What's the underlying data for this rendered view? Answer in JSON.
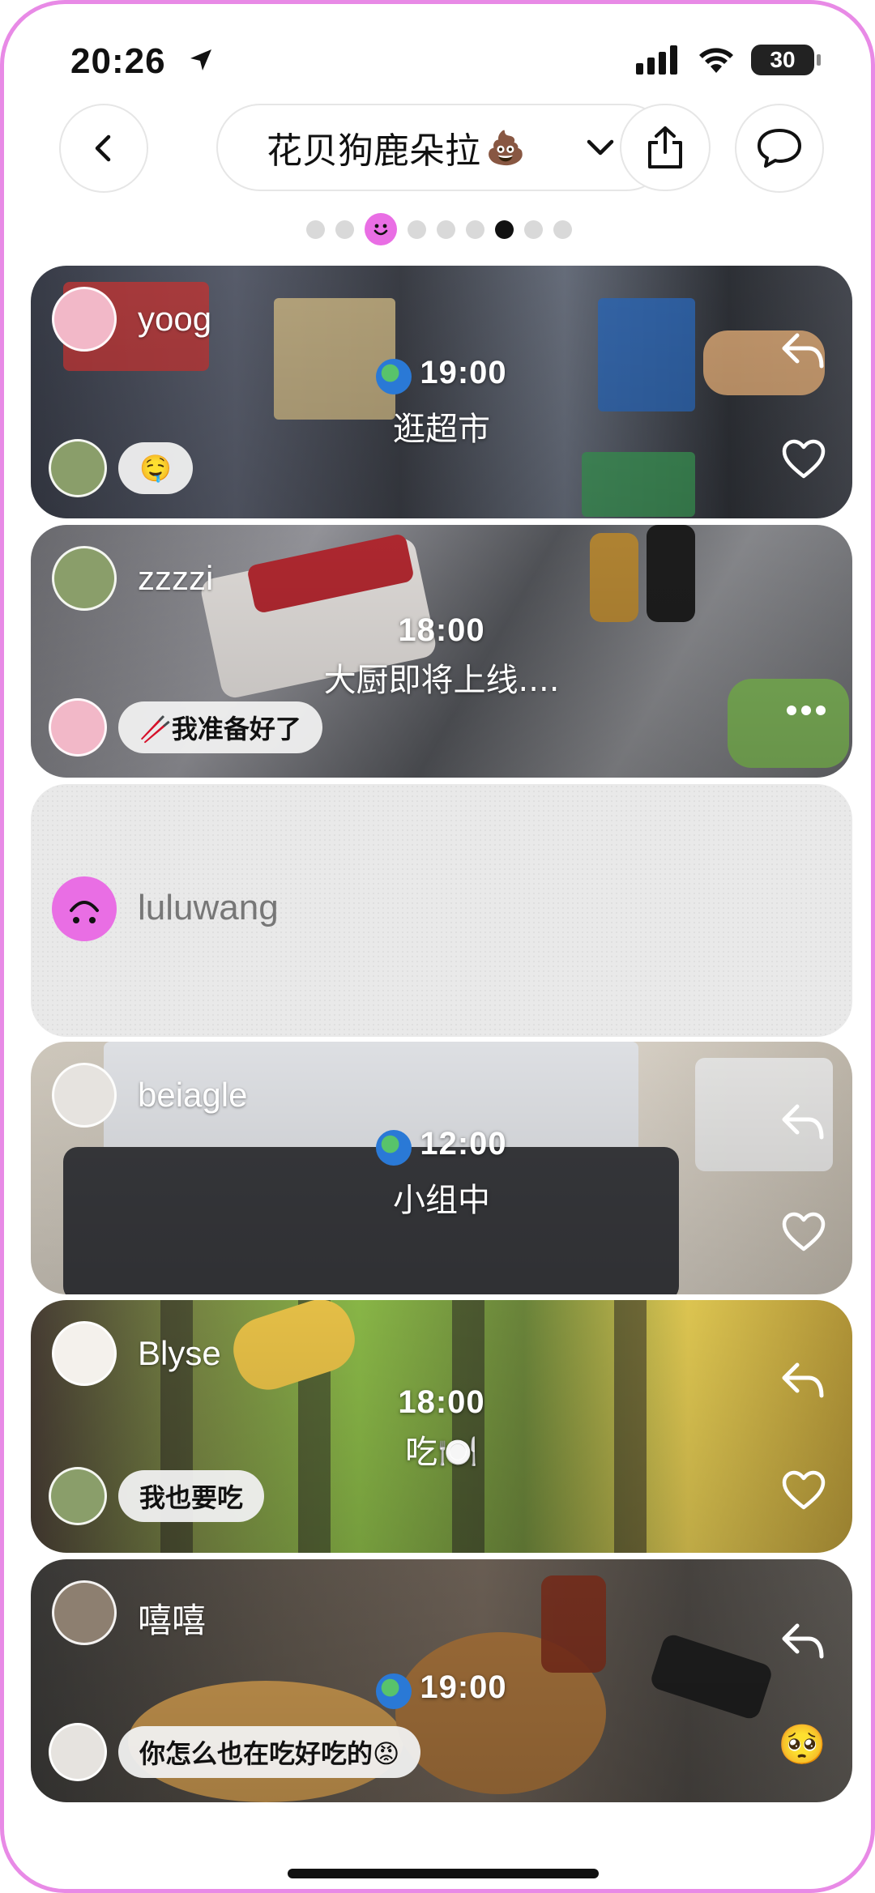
{
  "status": {
    "time": "20:26",
    "battery": "30"
  },
  "header": {
    "title": "花贝狗鹿朵拉",
    "title_emoji": "💩"
  },
  "pager": {
    "dots": 9,
    "active_index": 7,
    "smile_index": 2
  },
  "posts": [
    {
      "user": "yoog",
      "time": "19:00",
      "caption": "逛超市",
      "reply": "🤤",
      "has_globe": true
    },
    {
      "user": "zzzzi",
      "time": "18:00",
      "caption": "大厨即将上线....",
      "reply": "🥢我准备好了",
      "has_globe": false
    },
    {
      "user": "luluwang"
    },
    {
      "user": "beiagle",
      "time": "12:00",
      "caption": "小组中",
      "has_globe": true
    },
    {
      "user": "Blyse",
      "time": "18:00",
      "caption": "吃🍽️",
      "reply": "我也要吃",
      "has_globe": false
    },
    {
      "user": "嘻嘻",
      "time": "19:00",
      "reply": "你怎么也在吃好吃的😡",
      "reaction": "🥺",
      "has_globe": true
    }
  ],
  "colors": {
    "accent": "#e96ee4",
    "frame": "#e88ae6"
  }
}
